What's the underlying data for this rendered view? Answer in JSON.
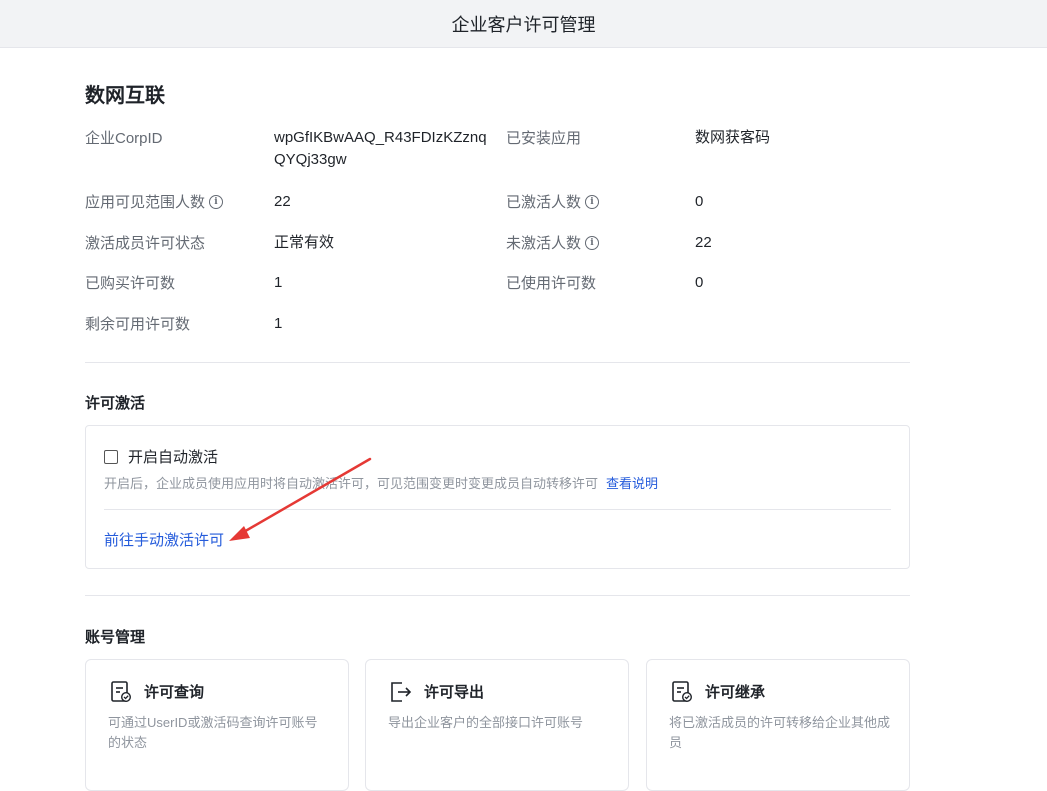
{
  "header": {
    "title": "企业客户许可管理"
  },
  "corp": {
    "name": "数网互联"
  },
  "info": {
    "rows": [
      {
        "left_label": "企业CorpID",
        "left_value": "wpGfIKBwAAQ_R43FDIzKZznqQYQj33gw",
        "right_label": "已安装应用",
        "right_value": "数网获客码"
      },
      {
        "left_label": "应用可见范围人数",
        "left_value": "22",
        "right_label": "已激活人数",
        "right_value": "0"
      },
      {
        "left_label": "激活成员许可状态",
        "left_value": "正常有效",
        "right_label": "未激活人数",
        "right_value": "22"
      },
      {
        "left_label": "已购买许可数",
        "left_value": "1",
        "right_label": "已使用许可数",
        "right_value": "0"
      },
      {
        "left_label": "剩余可用许可数",
        "left_value": "1"
      }
    ],
    "info_icon": "info-circle-icon"
  },
  "activation": {
    "section_title": "许可激活",
    "auto_label": "开启自动激活",
    "auto_checked": false,
    "hint": "开启后，企业成员使用应用时将自动激活许可，可见范围变更时变更成员自动转移许可",
    "hint_link": "查看说明",
    "manual_link": "前往手动激活许可"
  },
  "accounts": {
    "section_title": "账号管理",
    "cards": [
      {
        "title": "许可查询",
        "desc": "可通过UserID或激活码查询许可账号的状态",
        "icon": "license-doc-icon"
      },
      {
        "title": "许可导出",
        "desc": "导出企业客户的全部接口许可账号",
        "icon": "export-icon"
      },
      {
        "title": "许可继承",
        "desc": "将已激活成员的许可转移给企业其他成员",
        "icon": "license-doc-icon"
      }
    ]
  },
  "colors": {
    "link": "#245bdb",
    "annotation_arrow": "#e53935"
  }
}
